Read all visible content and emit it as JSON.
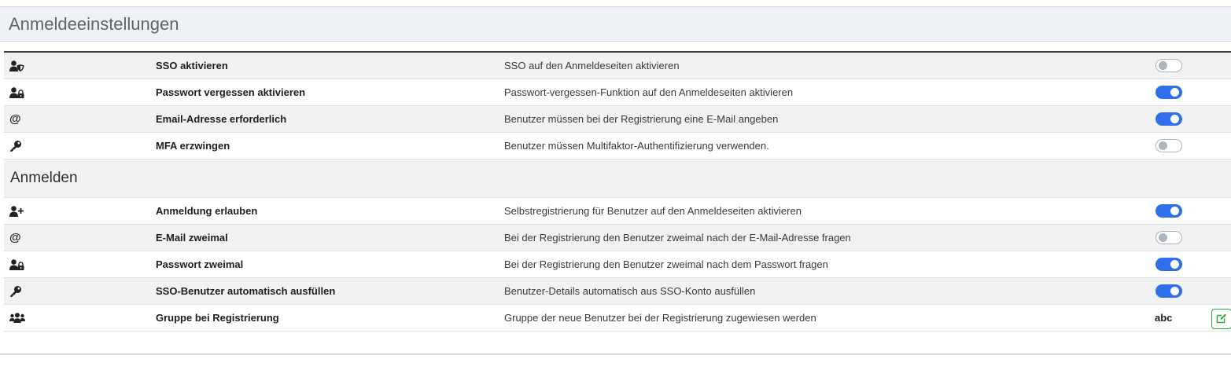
{
  "panel": {
    "title": "Anmeldeeinstellungen"
  },
  "login_settings": [
    {
      "icon": "user-shield-icon",
      "name": "SSO aktivieren",
      "description": "SSO auf den Anmeldeseiten aktivieren",
      "enabled": false
    },
    {
      "icon": "user-lock-icon",
      "name": "Passwort vergessen aktivieren",
      "description": "Passwort-vergessen-Funktion auf den Anmeldeseiten aktivieren",
      "enabled": true
    },
    {
      "icon": "at-icon",
      "name": "Email-Adresse erforderlich",
      "description": "Benutzer müssen bei der Registrierung eine E-Mail angeben",
      "enabled": true
    },
    {
      "icon": "key-icon",
      "name": "MFA erzwingen",
      "description": "Benutzer müssen Multifaktor-Authentifizierung verwenden.",
      "enabled": false
    }
  ],
  "signup_section": {
    "title": "Anmelden"
  },
  "signup_settings": [
    {
      "icon": "user-plus-icon",
      "name": "Anmeldung erlauben",
      "description": "Selbstregistrierung für Benutzer auf den Anmeldeseiten aktivieren",
      "enabled": true
    },
    {
      "icon": "at-icon",
      "name": "E-Mail zweimal",
      "description": "Bei der Registrierung den Benutzer zweimal nach der E-Mail-Adresse fragen",
      "enabled": false
    },
    {
      "icon": "user-lock-icon",
      "name": "Passwort zweimal",
      "description": "Bei der Registrierung den Benutzer zweimal nach dem Passwort fragen",
      "enabled": true
    },
    {
      "icon": "key-icon",
      "name": "SSO-Benutzer automatisch ausfüllen",
      "description": "Benutzer-Details automatisch aus SSO-Konto ausfüllen",
      "enabled": true
    },
    {
      "icon": "users-icon",
      "name": "Gruppe bei Registrierung",
      "description": "Gruppe der neue Benutzer bei der Registrierung zugewiesen werden",
      "value": "abc"
    }
  ],
  "colors": {
    "toggle_on": "#2f6fec",
    "toggle_off_border": "#adb5bd",
    "edit_button": "#28a745",
    "header_bg": "#eef2f7"
  },
  "edit_icon": "edit-icon"
}
